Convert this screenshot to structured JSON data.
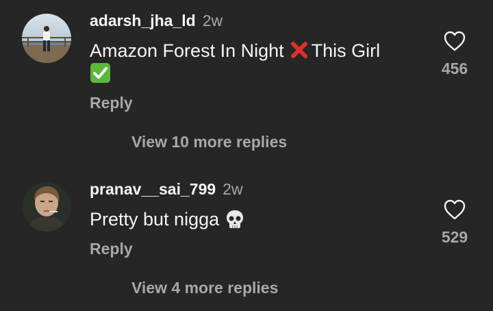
{
  "comments": [
    {
      "username": "adarsh_jha_ld",
      "time": "2w",
      "text_before_emoji": "Amazon Forest In Night",
      "text_after_emoji": "This Girl",
      "emoji_1": "cross-mark-emoji",
      "emoji_2": "check-mark-button-emoji",
      "reply_label": "Reply",
      "view_more_label": "View 10 more replies",
      "like_icon": "heart-outline-icon",
      "like_count": "456"
    },
    {
      "username": "pranav__sai_799",
      "time": "2w",
      "text": "Pretty but nigga",
      "emoji_1": "skull-emoji",
      "reply_label": "Reply",
      "view_more_label": "View 4 more replies",
      "like_icon": "heart-outline-icon",
      "like_count": "529"
    }
  ],
  "colors": {
    "background": "#262626",
    "primary_text": "#f5f5f5",
    "secondary_text": "#a8a8a8",
    "cross_red": "#e0302a",
    "check_green": "#5bb83a"
  }
}
